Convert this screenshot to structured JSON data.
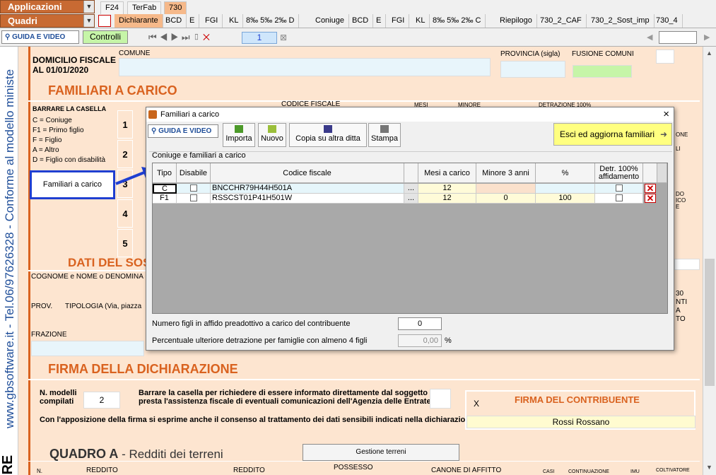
{
  "app": {
    "menu1": "Applicazioni",
    "menu2": "Quadri"
  },
  "top_tabs": [
    "F24",
    "TerFab",
    "730"
  ],
  "sub_tabs": [
    "Dichiarante",
    "BCD",
    "E",
    "FGI",
    "KL",
    "8‰ 5‰ 2‰ D",
    "Coniuge",
    "BCD",
    "E",
    "FGI",
    "KL",
    "8‰ 5‰ 2‰ C",
    "Riepilogo",
    "730_2_CAF",
    "730_2_Sost_imp",
    "730_4"
  ],
  "toolbar": {
    "guida": "GUIDA E VIDEO",
    "controlli": "Controlli",
    "page": "1"
  },
  "vstrip": {
    "text": "www.gbsoftware.it - Tel.06/97626328 - Conforme al modello ministe",
    "big": "ARE"
  },
  "form": {
    "domicilio": "DOMICILIO FISCALE\nAL 01/01/2020",
    "domicilio_l1": "DOMICILIO FISCALE",
    "domicilio_l2": "AL 01/01/2020",
    "comune": "COMUNE",
    "provincia": "PROVINCIA (sigla)",
    "fusione": "FUSIONE COMUNI",
    "familiari_title": "FAMILIARI A CARICO",
    "barrare": "BARRARE LA CASELLA",
    "legend": [
      "C = Coniuge",
      "F1 = Primo figlio",
      "F = Figlio",
      "A = Altro",
      "D = Figlio con disabilità"
    ],
    "codice_fiscale": "CODICE FISCALE",
    "mesi": "MESI",
    "minore": "MINORE",
    "detrazione": "DETRAZIONE 100%",
    "rows": [
      "1",
      "2",
      "3",
      "4",
      "5"
    ],
    "right_frag": [
      "ONE",
      "LI",
      "DO",
      "ICO",
      "E",
      "30",
      "NTI",
      "A",
      "TO"
    ],
    "dati_title": "DATI DEL SOSTI",
    "cognome": "COGNOME e NOME o DENOMINA",
    "prov": "PROV.",
    "tipologia": "TIPOLOGIA (Via, piazza",
    "frazione": "FRAZIONE",
    "firma_title": "FIRMA DELLA DICHIARAZIONE",
    "n_modelli": "N. modelli",
    "compilati": "compilati",
    "n_modelli_val": "2",
    "barrare_text1": "Barrare la casella per richiedere di essere informato direttamente dal soggetto che",
    "barrare_text2": "presta l'assistenza fiscale di eventuali comunicazioni dell'Agenzia delle Entrate",
    "consenso": "Con l'apposizione della firma si esprime anche il consenso al trattamento dei dati sensibili indicati nella dichiarazione",
    "firma_contribuente": "FIRMA DEL CONTRIBUENTE",
    "firma_x": "X",
    "firma_nome": "Rossi Rossano",
    "quadro_a": "QUADRO A",
    "quadro_a_sub": " - Redditi dei terreni",
    "gestione_terreni": "Gestione terreni",
    "bottom_headers": [
      "N.",
      "REDDITO",
      "REDDITO",
      "POSSESSO",
      "CANONE DI AFFITTO",
      "CASI",
      "CONTINUAZIONE",
      "IMU",
      "COLTIVATORE"
    ]
  },
  "callout": "Familiari a carico",
  "dialog": {
    "title": "Familiari a carico",
    "close": "×",
    "guida": "GUIDA E VIDEO",
    "buttons": [
      "Importa",
      "Nuovo",
      "Copia su altra ditta",
      "Stampa"
    ],
    "esci": "Esci ed aggiorna familiari",
    "group": "Coniuge e familiari a carico",
    "headers": [
      "Tipo",
      "Disabile",
      "Codice fiscale",
      "",
      "Mesi a carico",
      "Minore 3 anni",
      "%",
      "Detr. 100% affidamento"
    ],
    "rows": [
      {
        "tipo": "C",
        "cf": "BNCCHR79H44H501A",
        "mesi": "12",
        "minore": "",
        "perc": ""
      },
      {
        "tipo": "F1",
        "cf": "RSSCST01P41H501W",
        "mesi": "12",
        "minore": "0",
        "perc": "100"
      }
    ],
    "ellipsis": "...",
    "affido_label": "Numero figli in affido preadottivo a carico del contribuente",
    "affido_val": "0",
    "perc_label": "Percentuale ulteriore detrazione per famiglie con almeno 4 figli",
    "perc_val": "0,00",
    "perc_unit": "%"
  }
}
